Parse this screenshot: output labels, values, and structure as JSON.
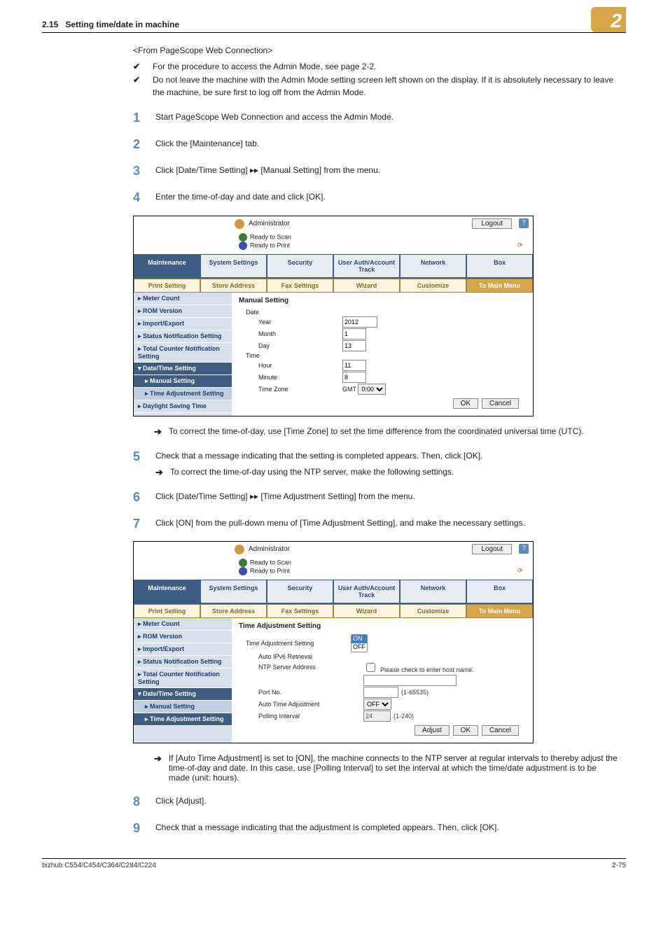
{
  "header": {
    "section_no": "2.15",
    "title": "Setting time/date in machine",
    "badge": "2"
  },
  "intro_heading": "<From PageScope Web Connection>",
  "bullets": [
    "For the procedure to access the Admin Mode, see page 2-2.",
    "Do not leave the machine with the Admin Mode setting screen left shown on the display. If it is absolutely necessary to leave the machine, be sure first to log off from the Admin Mode."
  ],
  "steps": {
    "1": "Start PageScope Web Connection and access the Admin Mode.",
    "2": "Click the [Maintenance] tab.",
    "3_a": "Click [Date/Time Setting] ",
    "3_b": " [Manual Setting] from the menu.",
    "4": "Enter the time-of-day and date and click [OK].",
    "4_sub": "To correct the time-of-day, use [Time Zone] to set the time difference from the coordinated universal time (UTC).",
    "5": "Check that a message indicating that the setting is completed appears. Then, click [OK].",
    "5_sub": "To correct the time-of-day using the NTP server, make the following settings.",
    "6_a": "Click [Date/Time Setting] ",
    "6_b": " [Time Adjustment Setting] from the menu.",
    "7": "Click [ON] from the pull-down menu of [Time Adjustment Setting], and make the necessary settings.",
    "7_sub": "If [Auto Time Adjustment] is set to [ON], the machine connects to the NTP server at regular intervals to thereby adjust the time-of-day and date. In this case, use [Polling Interval] to set the interval at which the time/date adjustment is to be made (unit: hours).",
    "8": "Click [Adjust].",
    "9": "Check that a message indicating that the adjustment is completed appears. Then, click [OK]."
  },
  "ui_common": {
    "role": "Administrator",
    "logout": "Logout",
    "help": "?",
    "ready_scan": "Ready to Scan",
    "ready_print": "Ready to Print",
    "tabs": {
      "maintenance": "Maintenance",
      "system": "System Settings",
      "security": "Security",
      "user": "User Auth/Account Track",
      "network": "Network",
      "box": "Box"
    },
    "subtabs": {
      "print": "Print Setting",
      "store": "Store Address",
      "fax": "Fax Settings",
      "wizard": "Wizard",
      "customize": "Customize",
      "tomain": "To Main Menu"
    },
    "sidebar": {
      "meter": "Meter Count",
      "rom": "ROM Version",
      "import": "Import/Export",
      "status_notif": "Status Notification Setting",
      "total_counter": "Total Counter Notification Setting",
      "datetime": "Date/Time Setting",
      "manual": "Manual Setting",
      "timeadj": "Time Adjustment Setting",
      "dst": "Daylight Saving Time"
    },
    "buttons": {
      "ok": "OK",
      "cancel": "Cancel",
      "adjust": "Adjust"
    }
  },
  "ui1": {
    "title": "Manual Setting",
    "date_label": "Date",
    "year_label": "Year",
    "year_value": "2012",
    "month_label": "Month",
    "month_value": "1",
    "day_label": "Day",
    "day_value": "13",
    "time_label": "Time",
    "hour_label": "Hour",
    "hour_value": "11",
    "minute_label": "Minute",
    "minute_value": "8",
    "tz_label": "Time Zone",
    "tz_prefix": "GMT",
    "tz_value": "0:00"
  },
  "ui2": {
    "title": "Time Adjustment Setting",
    "time_adj_label": "Time Adjustment Setting",
    "time_adj_value": "ON",
    "opt_on": "ON",
    "opt_off": "OFF",
    "ipv6_label": "Auto IPv6 Retrieval",
    "ntp_label": "NTP Server Address",
    "ntp_check": "Please check to enter host name.",
    "ntp_value": "",
    "port_label": "Port No.",
    "port_value": "",
    "port_hint": "(1-65535)",
    "auto_label": "Auto Time Adjustment",
    "auto_value": "OFF",
    "poll_label": "Polling Interval",
    "poll_value": "24",
    "poll_hint": "(1-240)"
  },
  "footer": {
    "left": "bizhub C554/C454/C364/C284/C224",
    "right": "2-75"
  }
}
